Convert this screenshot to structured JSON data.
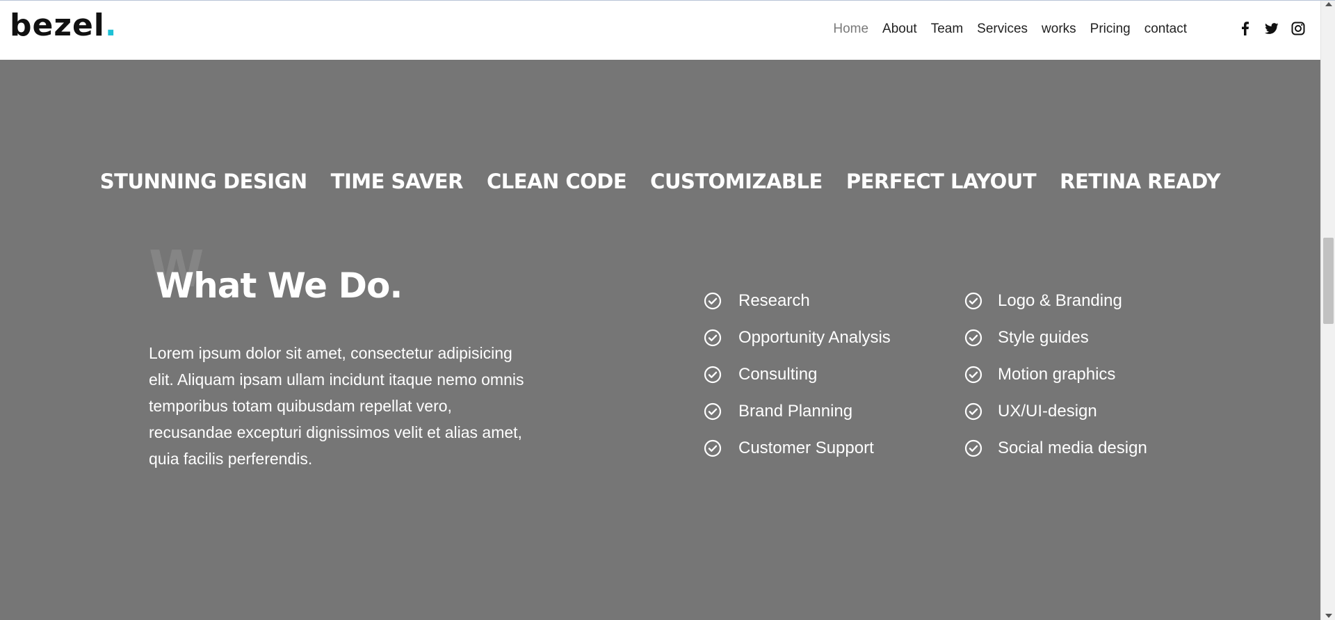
{
  "brand": {
    "name": "bezel",
    "dot": ".",
    "accent": "#1ec1d6"
  },
  "nav": {
    "items": [
      {
        "label": "Home",
        "active": true
      },
      {
        "label": "About",
        "active": false
      },
      {
        "label": "Team",
        "active": false
      },
      {
        "label": "Services",
        "active": false
      },
      {
        "label": "works",
        "active": false
      },
      {
        "label": "Pricing",
        "active": false
      },
      {
        "label": "contact",
        "active": false
      }
    ]
  },
  "social": {
    "icons": [
      "facebook-icon",
      "twitter-icon",
      "instagram-icon"
    ]
  },
  "features": [
    "STUNNING DESIGN",
    "TIME SAVER",
    "CLEAN CODE",
    "CUSTOMIZABLE",
    "PERFECT LAYOUT",
    "RETINA READY"
  ],
  "section": {
    "ghost_letter": "W",
    "title": "What We Do.",
    "description": "Lorem ipsum dolor sit amet, consectetur adipisicing elit. Aliquam ipsam ullam incidunt itaque nemo omnis temporibus totam quibusdam repellat vero, recusandae excepturi dignissimos velit et alias amet, quia facilis perferendis.",
    "services_left": [
      "Research",
      "Opportunity Analysis",
      "Consulting",
      "Brand Planning",
      "Customer Support"
    ],
    "services_right": [
      "Logo & Branding",
      "Style guides",
      "Motion graphics",
      "UX/UI-design",
      "Social media design"
    ]
  },
  "colors": {
    "section_bg": "#767676",
    "nav_active": "#7a7a7a"
  }
}
